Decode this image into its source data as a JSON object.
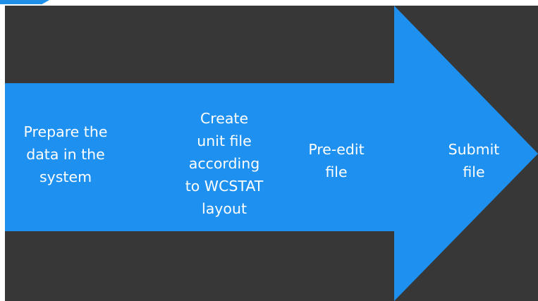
{
  "colors": {
    "background": "#373737",
    "arrow": "#1e90f0",
    "text": "#ffffff"
  },
  "steps": [
    {
      "label": "Prepare the\ndata in the\nsystem"
    },
    {
      "label": "Create\nunit file\naccording\nto WCSTAT\nlayout"
    },
    {
      "label": "Pre-edit\nfile"
    },
    {
      "label": "Submit\nfile"
    }
  ]
}
